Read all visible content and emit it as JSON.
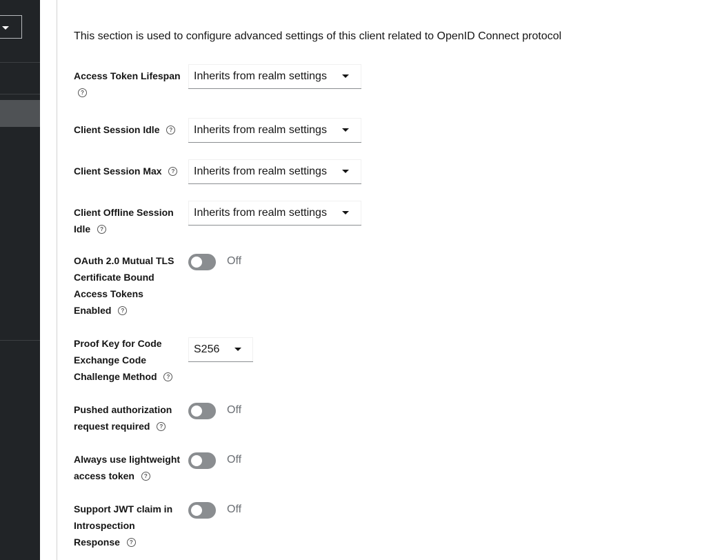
{
  "sidebar": {
    "dropdown_icon": "chevron-down-icon"
  },
  "intro": "This section is used to configure advanced settings of this client related to OpenID Connect protocol",
  "fields": {
    "access_token_lifespan": {
      "label": "Access Token Lifespan",
      "value": "Inherits from realm settings"
    },
    "client_session_idle": {
      "label": "Client Session Idle",
      "value": "Inherits from realm settings"
    },
    "client_session_max": {
      "label": "Client Session Max",
      "value": "Inherits from realm settings"
    },
    "client_offline_session_idle": {
      "label": "Client Offline Session Idle",
      "value": "Inherits from realm settings"
    },
    "oauth_mtls": {
      "label": "OAuth 2.0 Mutual TLS Certificate Bound Access Tokens Enabled",
      "state": "Off"
    },
    "pkce_method": {
      "label": "Proof Key for Code Exchange Code Challenge Method",
      "value": "S256"
    },
    "par_required": {
      "label": "Pushed authorization request required",
      "state": "Off"
    },
    "lightweight_token": {
      "label": "Always use lightweight access token",
      "state": "Off"
    },
    "jwt_introspection": {
      "label": "Support JWT claim in Introspection Response",
      "state": "Off"
    }
  },
  "help_glyph": "?"
}
